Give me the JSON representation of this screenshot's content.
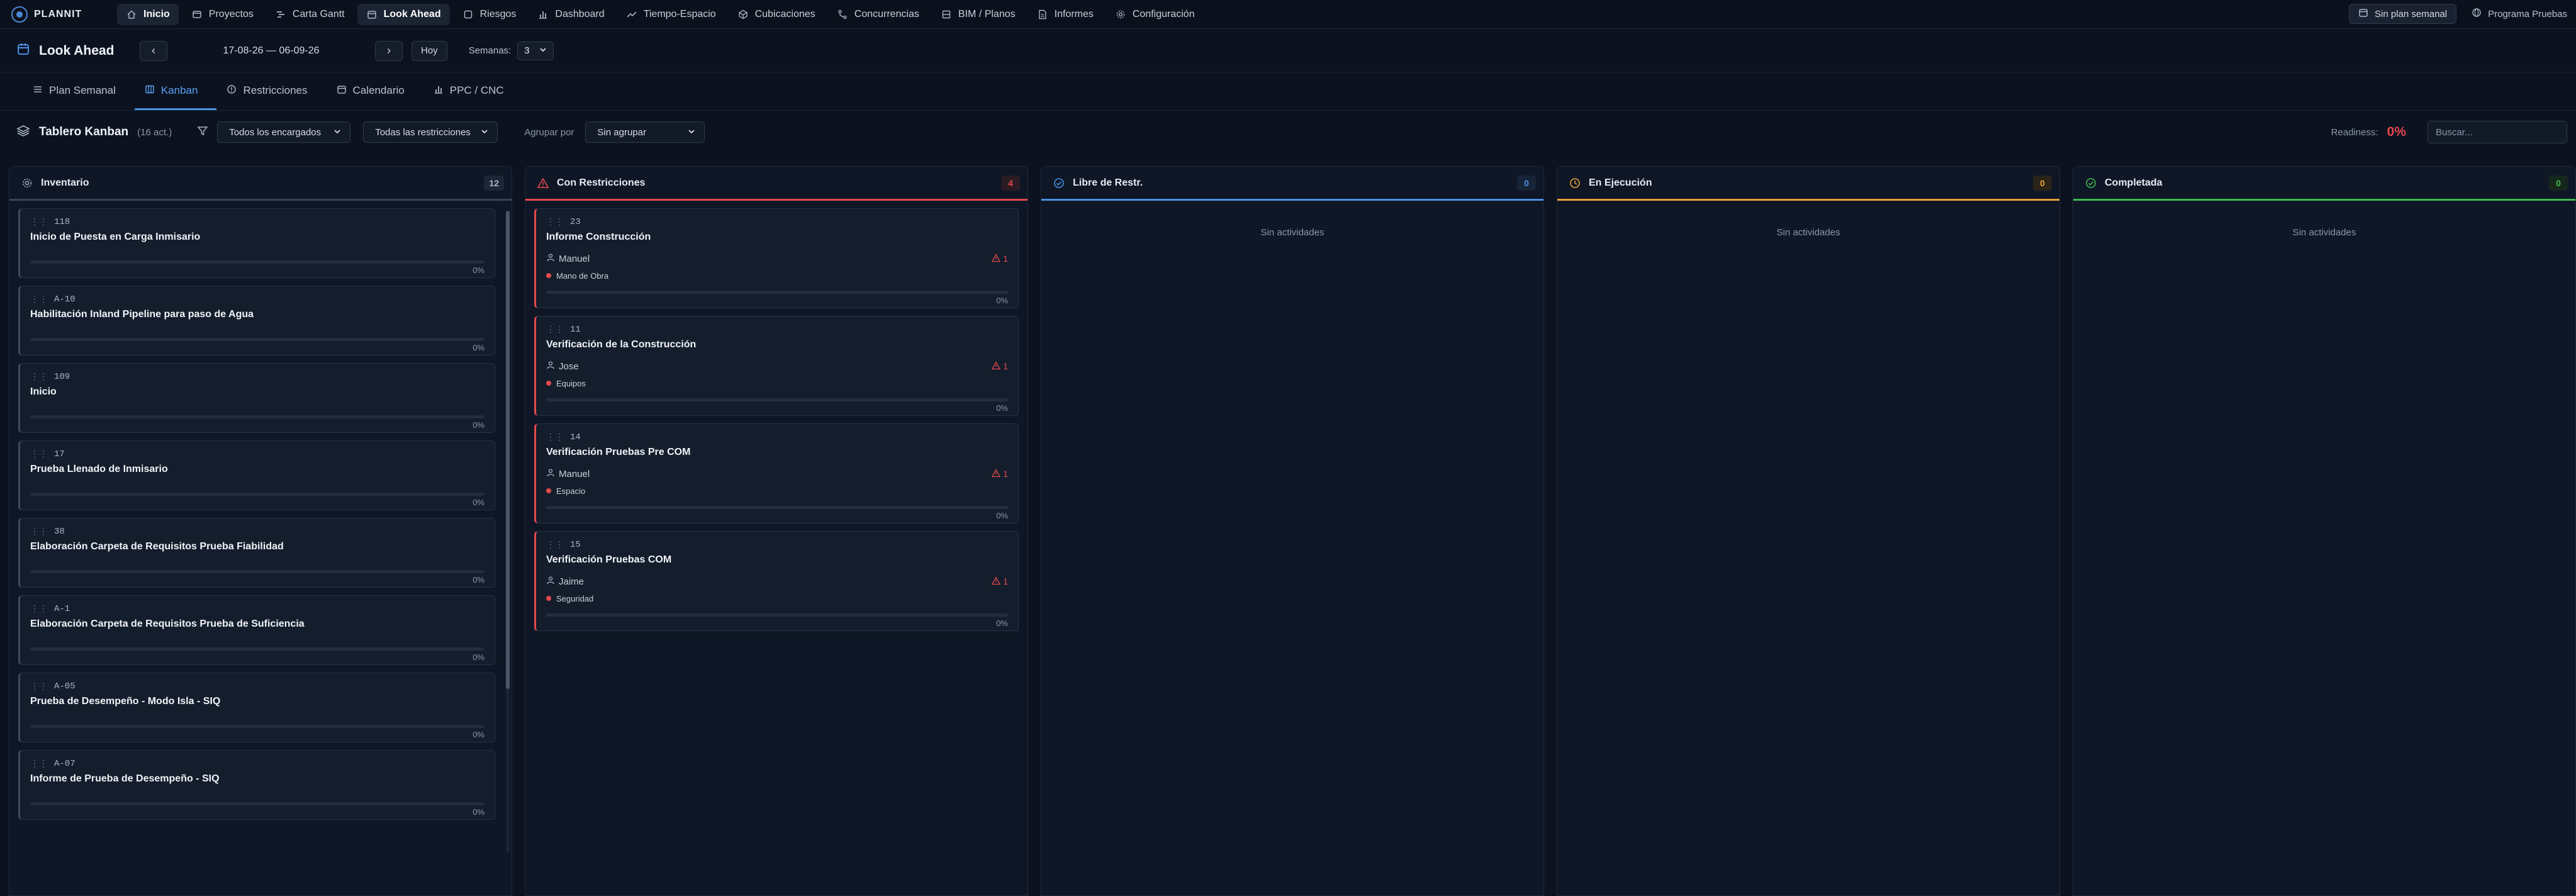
{
  "topnav": {
    "brand": "PLANNIT",
    "items": [
      {
        "label": "Inicio",
        "icon": "home-icon",
        "active": true
      },
      {
        "label": "Proyectos",
        "icon": "folder-icon",
        "active": false
      },
      {
        "label": "Carta Gantt",
        "icon": "gantt-icon",
        "active": false
      },
      {
        "label": "Look Ahead",
        "icon": "calendar-icon",
        "active": true
      },
      {
        "label": "Riesgos",
        "icon": "square-icon",
        "active": false
      },
      {
        "label": "Dashboard",
        "icon": "bar-chart-icon",
        "active": false
      },
      {
        "label": "Tiempo-Espacio",
        "icon": "trend-icon",
        "active": false
      },
      {
        "label": "Cubicaciones",
        "icon": "cube-icon",
        "active": false
      },
      {
        "label": "Concurrencias",
        "icon": "branch-icon",
        "active": false
      },
      {
        "label": "BIM / Planos",
        "icon": "box-icon",
        "active": false
      },
      {
        "label": "Informes",
        "icon": "document-icon",
        "active": false
      },
      {
        "label": "Configuración",
        "icon": "gear-icon",
        "active": false
      }
    ],
    "plan_button": "Sin plan semanal",
    "program_button": "Programa Pruebas"
  },
  "header": {
    "title": "Look Ahead",
    "prev": "‹",
    "next": "›",
    "date_range": "17-08-26 — 06-09-26",
    "today": "Hoy",
    "weeks_label": "Semanas:",
    "weeks_value": "3"
  },
  "tabs": [
    {
      "label": "Plan Semanal",
      "icon": "list-icon",
      "active": false
    },
    {
      "label": "Kanban",
      "icon": "kanban-icon",
      "active": true
    },
    {
      "label": "Restricciones",
      "icon": "alert-circle-icon",
      "active": false
    },
    {
      "label": "Calendario",
      "icon": "calendar-icon",
      "active": false
    },
    {
      "label": "PPC / CNC",
      "icon": "bar-chart-icon",
      "active": false
    }
  ],
  "toolbar": {
    "board_title": "Tablero Kanban",
    "count": "(16 act.)",
    "filter_assignee": "Todos los encargados",
    "filter_restrictions": "Todas las restricciones",
    "group_label": "Agrupar por",
    "group_value": "Sin agrupar",
    "readiness_label": "Readiness:",
    "readiness_value": "0%",
    "search_placeholder": "Buscar..."
  },
  "columns": [
    {
      "name": "Inventario",
      "count": "12",
      "accent": "#3a4556",
      "icon": "settings-icon",
      "cards": [
        {
          "id": "118",
          "title": "Inicio de Puesta en Carga Inmisario",
          "progress": 0,
          "pct": "0%"
        },
        {
          "id": "A-10",
          "title": "Habilitación Inland Pipeline para paso de Agua",
          "progress": 0,
          "pct": "0%"
        },
        {
          "id": "109",
          "title": "Inicio",
          "progress": 0,
          "pct": "0%"
        },
        {
          "id": "17",
          "title": "Prueba Llenado de Inmisario",
          "progress": 0,
          "pct": "0%"
        },
        {
          "id": "38",
          "title": "Elaboración Carpeta de Requisitos Prueba Fiabilidad",
          "progress": 0,
          "pct": "0%"
        },
        {
          "id": "A-1",
          "title": "Elaboración Carpeta de Requisitos Prueba de Suficiencia",
          "progress": 0,
          "pct": "0%"
        },
        {
          "id": "A-05",
          "title": "Prueba de Desempeño - Modo Isla - SIQ",
          "progress": 0,
          "pct": "0%"
        },
        {
          "id": "A-07",
          "title": "Informe de Prueba de Desempeño - SIQ",
          "progress": 0,
          "pct": "0%"
        }
      ],
      "empty": ""
    },
    {
      "name": "Con Restricciones",
      "count": "4",
      "accent": "#e5484d",
      "icon": "warning-icon",
      "cards": [
        {
          "id": "23",
          "title": "Informe Construcción",
          "person": "Manuel",
          "warn": "1",
          "tag": "Mano de Obra",
          "progress": 0,
          "pct": "0%"
        },
        {
          "id": "11",
          "title": "Verificación de la Construcción",
          "person": "Jose",
          "warn": "1",
          "tag": "Equipos",
          "progress": 0,
          "pct": "0%"
        },
        {
          "id": "14",
          "title": "Verificación Pruebas Pre COM",
          "person": "Manuel",
          "warn": "1",
          "tag": "Espacio",
          "progress": 0,
          "pct": "0%"
        },
        {
          "id": "15",
          "title": "Verificación Pruebas COM",
          "person": "Jaime",
          "warn": "1",
          "tag": "Seguridad",
          "progress": 0,
          "pct": "0%"
        }
      ],
      "empty": ""
    },
    {
      "name": "Libre de Restr.",
      "count": "0",
      "accent": "#4a90e2",
      "icon": "check-circle-icon",
      "cards": [],
      "empty": "Sin actividades"
    },
    {
      "name": "En Ejecución",
      "count": "0",
      "accent": "#e8a13a",
      "icon": "clock-icon",
      "cards": [],
      "empty": "Sin actividades"
    },
    {
      "name": "Completada",
      "count": "0",
      "accent": "#3fb950",
      "icon": "check-circle-icon",
      "cards": [],
      "empty": "Sin actividades"
    }
  ]
}
